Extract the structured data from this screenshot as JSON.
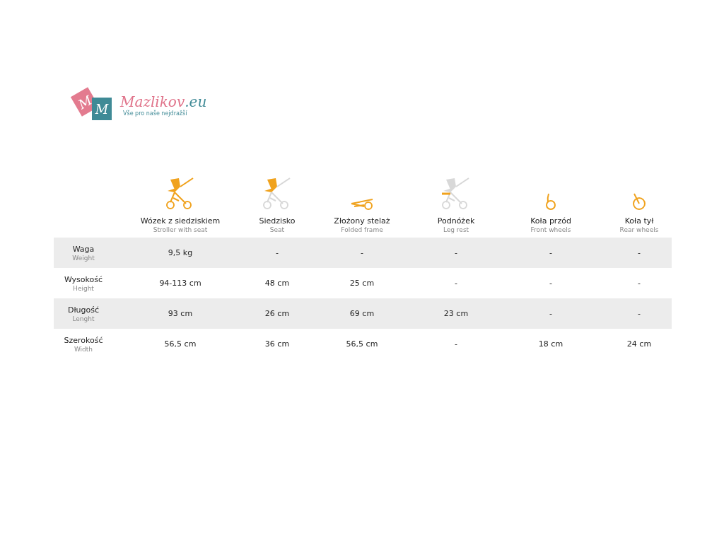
{
  "logo": {
    "bag_letters": [
      "M",
      "M"
    ],
    "name": "Mazlikov",
    "domain": ".eu",
    "tagline": "Vše pro naše nejdražší"
  },
  "columns": [
    {
      "kind": "stroller",
      "label": "Wózek z siedziskiem",
      "sublabel": "Stroller with seat"
    },
    {
      "kind": "seat",
      "label": "Siedzisko",
      "sublabel": "Seat"
    },
    {
      "kind": "frame",
      "label": "Złożony stelaż",
      "sublabel": "Folded frame"
    },
    {
      "kind": "legrest",
      "label": "Podnóżek",
      "sublabel": "Leg rest"
    },
    {
      "kind": "front-wheel",
      "label": "Koła przód",
      "sublabel": "Front wheels"
    },
    {
      "kind": "rear-wheel",
      "label": "Koła tył",
      "sublabel": "Rear wheels"
    }
  ],
  "rows": [
    {
      "label": "Waga",
      "sublabel": "Weight",
      "values": [
        "9,5 kg",
        "-",
        "-",
        "-",
        "-",
        "-"
      ]
    },
    {
      "label": "Wysokość",
      "sublabel": "Height",
      "values": [
        "94-113 cm",
        "48 cm",
        "25 cm",
        "-",
        "-",
        "-"
      ]
    },
    {
      "label": "Długość",
      "sublabel": "Lenght",
      "values": [
        "93 cm",
        "26 cm",
        "69 cm",
        "23 cm",
        "-",
        "-"
      ]
    },
    {
      "label": "Szerokość",
      "sublabel": "Width",
      "values": [
        "56,5 cm",
        "36 cm",
        "56,5 cm",
        "-",
        "18 cm",
        "24 cm"
      ]
    }
  ]
}
